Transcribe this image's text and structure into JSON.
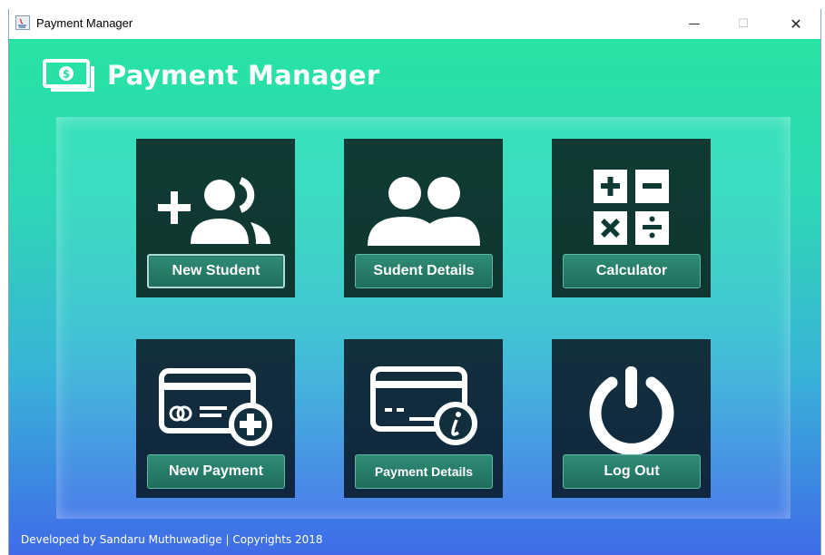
{
  "window": {
    "title": "Payment Manager",
    "controls": {
      "minimize": "—",
      "maximize": "☐",
      "close": "✕"
    }
  },
  "brand": {
    "title": "Payment Manager",
    "icon": "money-bill-icon"
  },
  "tiles": [
    {
      "label": "New Student",
      "icon": "add-user-icon"
    },
    {
      "label": "Sudent Details",
      "icon": "users-icon"
    },
    {
      "label": "Calculator",
      "icon": "calculator-icon"
    },
    {
      "label": "New Payment",
      "icon": "credit-card-add-icon"
    },
    {
      "label": "Payment Details",
      "icon": "credit-card-info-icon"
    },
    {
      "label": "Log Out",
      "icon": "power-icon"
    }
  ],
  "footer": {
    "text": "Developed by Sandaru Muthuwadige | Copyrights 2018"
  },
  "colors": {
    "tile_bg_top": "#0f3a33",
    "tile_bg_bottom": "#12273f",
    "button": "#2a7d69",
    "gradient_top": "#27e3a3",
    "gradient_bottom": "#3f6be8"
  }
}
